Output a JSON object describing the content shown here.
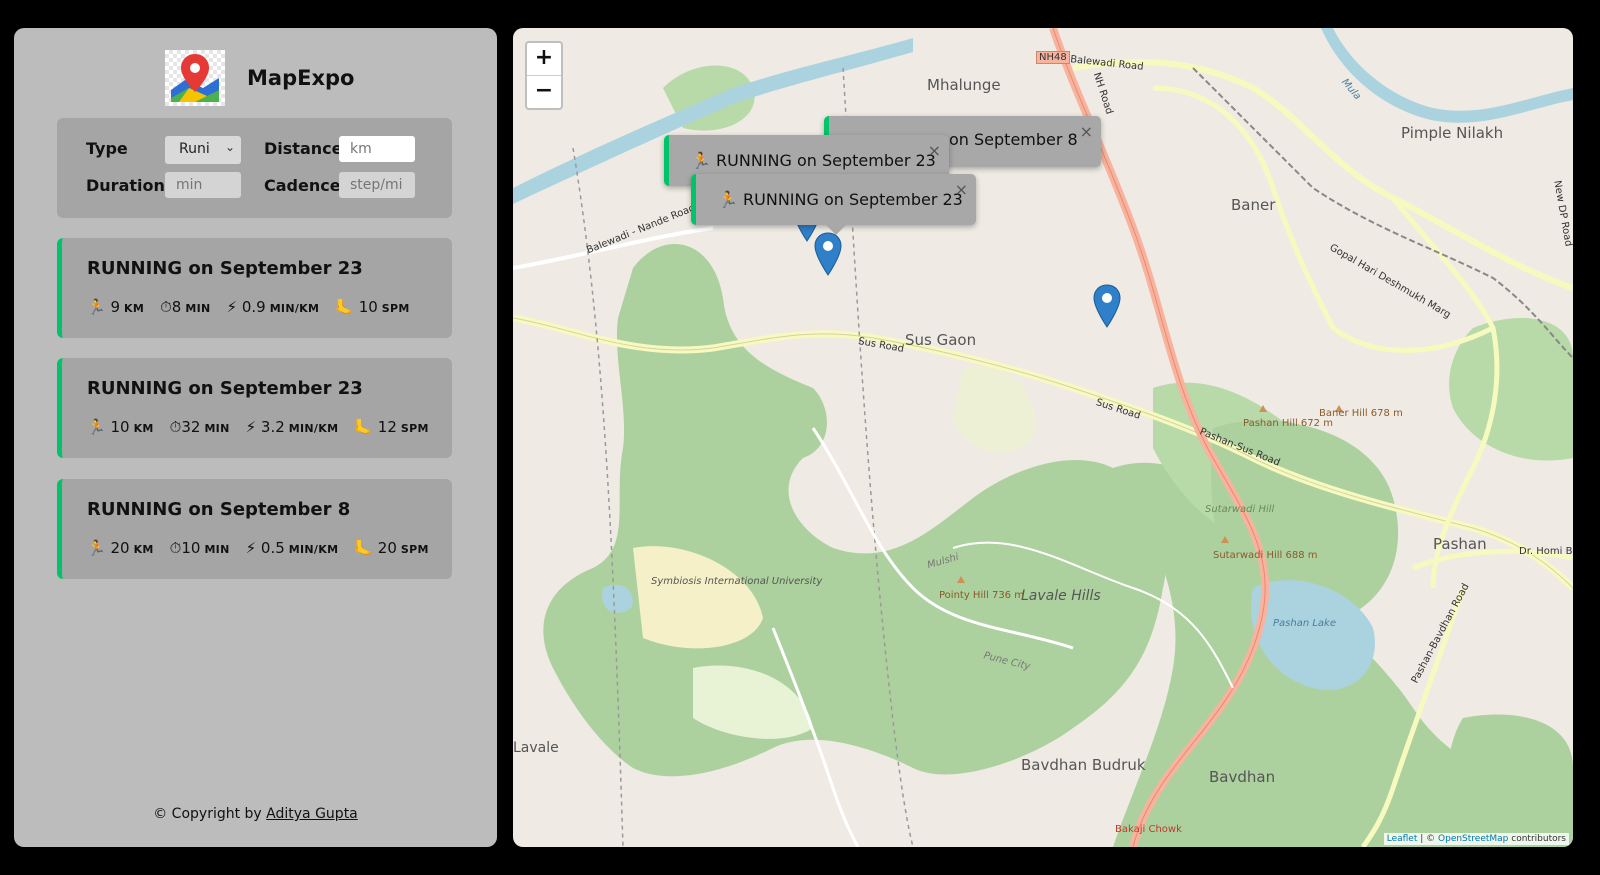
{
  "app": {
    "name": "MapExpo"
  },
  "form": {
    "type_label": "Type",
    "type_value": "Runi",
    "distance_label": "Distance",
    "distance_placeholder": "km",
    "duration_label": "Duration",
    "duration_placeholder": "min",
    "cadence_label": "Cadence",
    "cadence_placeholder": "step/mi"
  },
  "workouts": [
    {
      "title": "RUNNING on September 23",
      "distance": "9",
      "duration": "8",
      "pace": "0.9",
      "cadence": "10"
    },
    {
      "title": "RUNNING on September 23",
      "distance": "10",
      "duration": "32",
      "pace": "3.2",
      "cadence": "12"
    },
    {
      "title": "RUNNING on September 8",
      "distance": "20",
      "duration": "10",
      "pace": "0.5",
      "cadence": "20"
    }
  ],
  "units": {
    "distance": "KM",
    "duration": "MIN",
    "pace": "MIN/KM",
    "cadence": "SPM"
  },
  "icons": {
    "runner": "runner-icon",
    "stopwatch": "stopwatch-icon",
    "bolt": "lightning-icon",
    "foot": "footprint-icon"
  },
  "footer": {
    "prefix": "© Copyright by ",
    "author": "Aditya Gupta"
  },
  "map": {
    "zoom_in": "+",
    "zoom_out": "−",
    "popups": [
      {
        "text": "on September 8",
        "close": "×"
      },
      {
        "text": "RUNNING on September 23",
        "close": "×"
      },
      {
        "text": "RUNNING on September 23",
        "close": "×"
      }
    ],
    "places": {
      "mhalunge": "Mhalunge",
      "pimple": "Pimple Nilakh",
      "baner": "Baner",
      "sus_gaon": "Sus Gaon",
      "pashan": "Pashan",
      "lavale": "Lavale",
      "lavale_hills": "Lavale Hills",
      "bavdhan_budruk": "Bavdhan Budruk",
      "bavdhan": "Bavdhan",
      "symbiosis": "Symbiosis International University",
      "pashan_lake": "Pashan Lake",
      "sutarwadi": "Sutarwadi Hill",
      "sutarwadi2": "Sutarwadi Hill 688 m",
      "pashan_hill": "Pashan Hill 672 m",
      "baner_hill": "Baner Hill 678 m",
      "pointy_hill": "Pointy Hill 736 m"
    },
    "roads": {
      "sus1": "Sus Road",
      "sus2": "Sus Road",
      "pashan_sus": "Pashan-Sus Road",
      "balewadi": "Balewadi Road",
      "balewadi_nande": "Balewadi - Nande Road",
      "nh48": "NH48",
      "nh_road": "NH Road",
      "gopal": "Gopal Hari Deshmukh Marg",
      "pune_city": "Pune City",
      "bhabha": "Dr. Homi Bhabha",
      "pashan_bavdhan": "Pashan-Bavdhan Road",
      "mutha": "Mula",
      "new_dp": "New DP Road",
      "bakul": "Bakaji Chowk",
      "mulshi": "Mulshi"
    },
    "attribution": {
      "leaflet": "Leaflet",
      "sep": " | © ",
      "osm": "OpenStreetMap",
      "suffix": " contributors"
    }
  }
}
